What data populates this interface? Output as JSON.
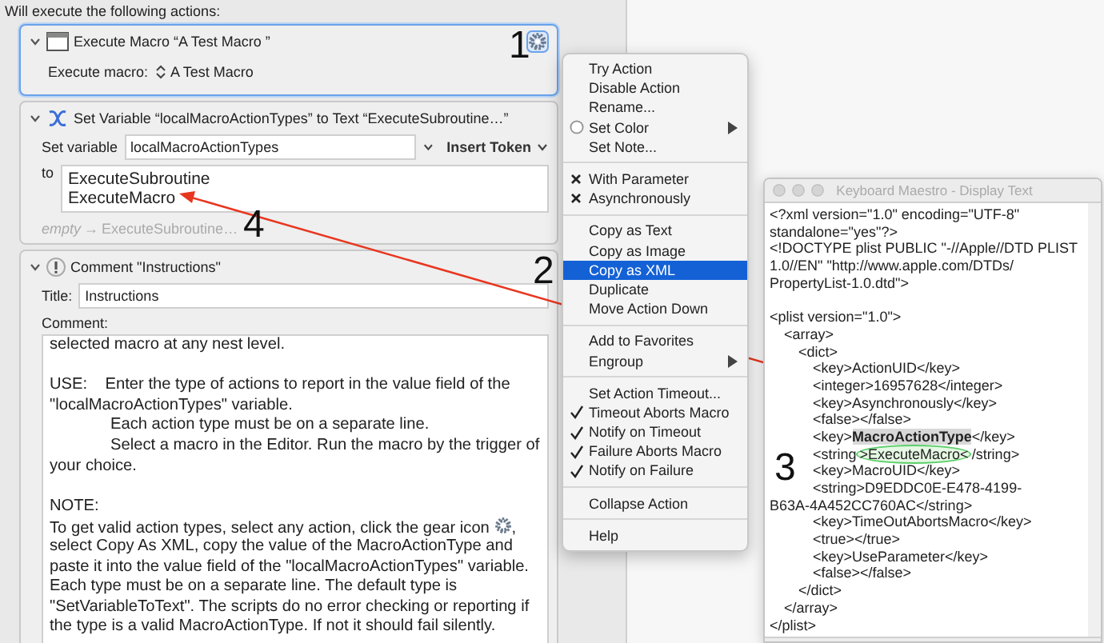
{
  "editor": {
    "heading": "Will execute the following actions:",
    "actions": [
      {
        "kind": "execute_macro",
        "title": "Execute Macro “A Test  Macro ”",
        "selected": true,
        "expanded": true,
        "label": "Execute macro:",
        "popup_value": "A Test  Macro"
      },
      {
        "kind": "set_variable",
        "title": "Set Variable “localMacroActionTypes” to Text “ExecuteSubroutine…”",
        "selected": false,
        "expanded": true,
        "variable_label": "Set variable",
        "variable_value": "localMacroActionTypes",
        "token_button": "Insert Token",
        "to_label": "to",
        "text_lines": [
          "ExecuteSubroutine",
          "ExecuteMacro"
        ],
        "preview_empty": "empty",
        "preview_arrow": "→",
        "preview_value": "ExecuteSubroutine…"
      },
      {
        "kind": "comment",
        "title": "Comment \"Instructions\"",
        "selected": false,
        "expanded": true,
        "title_label": "Title:",
        "title_value": "Instructions",
        "comment_label": "Comment:",
        "lines": [
          {
            "text": "selected macro at any nest level.",
            "indent": false
          },
          {
            "text": "USE:    Enter the type of actions to report in the value field of the",
            "indent": false,
            "gap_before": true
          },
          {
            "text": "\"localMacroActionTypes\" variable.",
            "indent": false
          },
          {
            "text": "Each action type must be on a separate line.",
            "indent": true
          },
          {
            "text": "Select a macro in the Editor. Run the macro by the trigger of",
            "indent": true
          },
          {
            "text": "your choice.",
            "indent": false
          },
          {
            "text": "NOTE:",
            "indent": false,
            "gap_before": true
          },
          {
            "kind": "gear_icon_line",
            "text": "To get valid action types, select any action, click the gear icon",
            "tail": ",",
            "indent": false
          },
          {
            "text": "select Copy As XML, copy the value of the MacroActionType and",
            "indent": false
          },
          {
            "text": "paste it into the value field of the \"localMacroActionTypes\" variable.",
            "indent": false
          },
          {
            "text": "Each type must be on a separate line. The default type is",
            "indent": false
          },
          {
            "text": "\"SetVariableToText\". The scripts do no error checking or reporting if",
            "indent": false
          },
          {
            "text": "the type is a valid MacroActionType. If not it should fail silently.",
            "indent": false
          }
        ]
      }
    ]
  },
  "context_menu": {
    "items": [
      {
        "kind": "item",
        "label": "Try Action",
        "submenu": false,
        "selected": false
      },
      {
        "kind": "item",
        "label": "Disable Action",
        "submenu": false,
        "selected": false
      },
      {
        "kind": "item",
        "label": "Rename...",
        "submenu": false,
        "selected": false
      },
      {
        "kind": "radio_item",
        "label": "Set Color",
        "submenu": true,
        "selected": false
      },
      {
        "kind": "item",
        "label": "Set Note...",
        "submenu": false,
        "selected": false
      },
      {
        "kind": "separator"
      },
      {
        "kind": "cross_item",
        "label": "With Parameter",
        "submenu": false,
        "selected": false
      },
      {
        "kind": "cross_item",
        "label": "Asynchronously",
        "submenu": false,
        "selected": false
      },
      {
        "kind": "separator"
      },
      {
        "kind": "item",
        "label": "Copy as Text",
        "submenu": false,
        "selected": false
      },
      {
        "kind": "item",
        "label": "Copy as Image",
        "submenu": false,
        "selected": false
      },
      {
        "kind": "item",
        "label": "Copy as XML",
        "submenu": false,
        "selected": true
      },
      {
        "kind": "item",
        "label": "Duplicate",
        "submenu": false,
        "selected": false
      },
      {
        "kind": "item",
        "label": "Move Action Down",
        "submenu": false,
        "selected": false
      },
      {
        "kind": "separator"
      },
      {
        "kind": "item",
        "label": "Add to Favorites",
        "submenu": false,
        "selected": false
      },
      {
        "kind": "item",
        "label": "Engroup",
        "submenu": true,
        "selected": false
      },
      {
        "kind": "separator"
      },
      {
        "kind": "item",
        "label": "Set Action Timeout...",
        "submenu": false,
        "selected": false
      },
      {
        "kind": "check_item",
        "label": "Timeout Aborts Macro",
        "submenu": false,
        "selected": false
      },
      {
        "kind": "check_item",
        "label": "Notify on Timeout",
        "submenu": false,
        "selected": false
      },
      {
        "kind": "check_item",
        "label": "Failure Aborts Macro",
        "submenu": false,
        "selected": false
      },
      {
        "kind": "check_item",
        "label": "Notify on Failure",
        "submenu": false,
        "selected": false
      },
      {
        "kind": "separator"
      },
      {
        "kind": "item",
        "label": "Collapse Action",
        "submenu": false,
        "selected": false
      },
      {
        "kind": "separator"
      },
      {
        "kind": "item",
        "label": "Help",
        "submenu": false,
        "selected": false
      }
    ]
  },
  "display_window": {
    "title": "Keyboard Maestro - Display Text",
    "lines": [
      {
        "text": "<?xml version=\"1.0\" encoding=\"UTF-8\""
      },
      {
        "text": "standalone=\"yes\"?>"
      },
      {
        "text": "<!DOCTYPE plist PUBLIC \"-//Apple//DTD PLIST"
      },
      {
        "text": "1.0//EN\" \"http://www.apple.com/DTDs/"
      },
      {
        "text": "PropertyList-1.0.dtd\">"
      },
      {
        "text": "<plist version=\"1.0\">",
        "gap_before": true,
        "children": [
          {
            "text": "<array>",
            "children": [
              {
                "text": "<dict>",
                "children": [
                  {
                    "text": "<key>ActionUID</key>"
                  },
                  {
                    "text": "<integer>16957628</integer>"
                  },
                  {
                    "text": "<key>Asynchronously</key>"
                  },
                  {
                    "text": "<false></false>"
                  },
                  {
                    "segments": [
                      {
                        "kind": "plain",
                        "text": "<key>"
                      },
                      {
                        "kind": "selection",
                        "text": "MacroActionType"
                      },
                      {
                        "kind": "plain",
                        "text": "</key>"
                      }
                    ]
                  },
                  {
                    "segments": [
                      {
                        "kind": "plain",
                        "text": "<string"
                      },
                      {
                        "kind": "circled",
                        "text": ">ExecuteMacro<"
                      },
                      {
                        "kind": "plain",
                        "text": "/string>"
                      }
                    ]
                  },
                  {
                    "text": "<key>MacroUID</key>"
                  },
                  {
                    "text": "<string>D9EDDC0E-E478-4199-",
                    "continuation": "B63A-4A452CC760AC</string>"
                  },
                  {
                    "text": "<key>TimeOutAbortsMacro</key>"
                  },
                  {
                    "text": "<true></true>"
                  },
                  {
                    "text": "<key>UseParameter</key>"
                  },
                  {
                    "text": "<false></false>"
                  }
                ]
              },
              {
                "text": "</dict>"
              }
            ]
          },
          {
            "text": "</array>"
          }
        ]
      },
      {
        "text": "</plist>"
      }
    ]
  },
  "annotations": [
    {
      "label": "1"
    },
    {
      "label": "2"
    },
    {
      "label": "3"
    },
    {
      "label": "4"
    }
  ]
}
